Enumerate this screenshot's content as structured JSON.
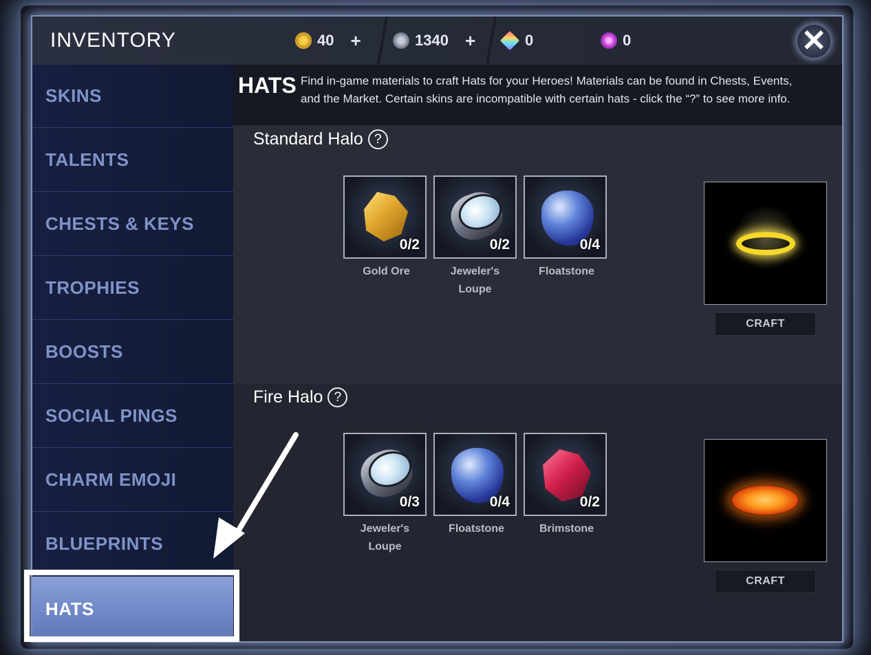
{
  "header": {
    "title": "INVENTORY",
    "currencies": [
      {
        "icon": "gold-coin-icon",
        "value": "40",
        "plus": "+"
      },
      {
        "icon": "silver-glory-icon",
        "value": "1340",
        "plus": "+"
      },
      {
        "icon": "prism-gem-icon",
        "value": "0"
      },
      {
        "icon": "essence-spark-icon",
        "value": "0"
      }
    ],
    "close_label": "✕"
  },
  "sidebar": {
    "items": [
      {
        "label": "SKINS"
      },
      {
        "label": "TALENTS"
      },
      {
        "label": "CHESTS & KEYS"
      },
      {
        "label": "TROPHIES"
      },
      {
        "label": "BOOSTS"
      },
      {
        "label": "SOCIAL PINGS"
      },
      {
        "label": "CHARM EMOJI"
      },
      {
        "label": "BLUEPRINTS"
      },
      {
        "label": "HATS",
        "active": true
      }
    ]
  },
  "info": {
    "title": "HATS",
    "text": "Find in-game materials to craft Hats for your Heroes! Materials can be found in Chests, Events, and the Market. Certain skins are incompatible with certain hats - click the “?” to see more info."
  },
  "recipes": [
    {
      "name": "Standard Halo",
      "help": "?",
      "materials": [
        {
          "name": "Gold Ore",
          "count": "0/2",
          "icon": "gold-ore-icon"
        },
        {
          "name": "Jeweler's Loupe",
          "count": "0/2",
          "icon": "jewelers-loupe-icon"
        },
        {
          "name": "Floatstone",
          "count": "0/4",
          "icon": "floatstone-icon"
        }
      ],
      "result_icon": "standard-halo-icon",
      "craft_label": "CRAFT"
    },
    {
      "name": "Fire Halo",
      "help": "?",
      "materials": [
        {
          "name": "Jeweler's Loupe",
          "count": "0/3",
          "icon": "jewelers-loupe-icon"
        },
        {
          "name": "Floatstone",
          "count": "0/4",
          "icon": "floatstone-icon"
        },
        {
          "name": "Brimstone",
          "count": "0/2",
          "icon": "brimstone-icon"
        }
      ],
      "result_icon": "fire-halo-icon",
      "craft_label": "CRAFT"
    }
  ],
  "annotation": {
    "arrow_color": "#ffffff",
    "highlight_color": "#ffffff"
  }
}
